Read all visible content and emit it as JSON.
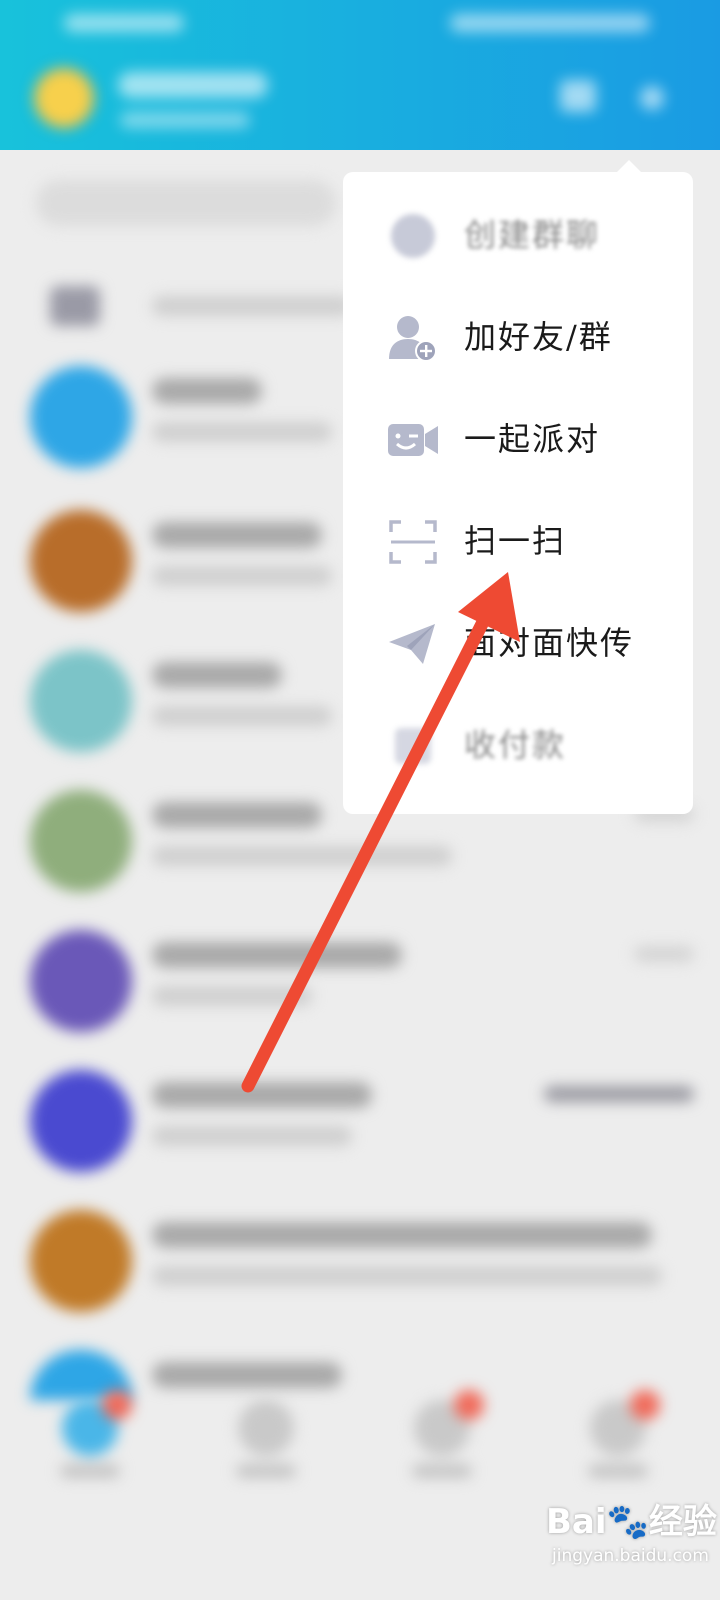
{
  "menu": {
    "items": [
      {
        "label": "创建群聊",
        "icon": "group-chat-icon",
        "faded": true
      },
      {
        "label": "加好友/群",
        "icon": "add-friend-icon",
        "faded": false
      },
      {
        "label": "一起派对",
        "icon": "party-camera-icon",
        "faded": false
      },
      {
        "label": "扫一扫",
        "icon": "scan-icon",
        "faded": false
      },
      {
        "label": "面对面快传",
        "icon": "paper-plane-icon",
        "faded": false
      },
      {
        "label": "收付款",
        "icon": "payment-icon",
        "faded": true
      }
    ]
  },
  "annotation": {
    "color": "#ee4a33"
  },
  "watermark": {
    "logo": "Bai🐾经验",
    "url": "jingyan.baidu.com"
  },
  "colors": {
    "header_start": "#18c2db",
    "header_end": "#1a9be3",
    "badge": "#f06a5a"
  }
}
